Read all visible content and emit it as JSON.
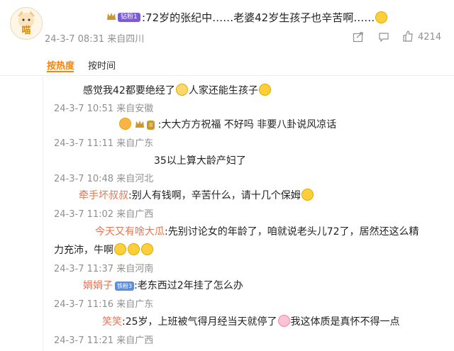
{
  "post": {
    "avatar_text": "喵",
    "badge_label": "钻粉1",
    "text": ":72岁的张纪中……老婆42岁生孩子也辛苦啊……",
    "timestamp": "24-3-7 08:31 来自四川",
    "like_count": "4214"
  },
  "tabs": {
    "hot": "按热度",
    "time": "按时间"
  },
  "comments": [
    {
      "text": "感觉我42都要绝经了",
      "text2": "人家还能生孩子",
      "meta": "24-3-7 10:51 来自安徽"
    },
    {
      "text": ":大大方方祝福 不好吗 非要八卦说风凉话",
      "meta": "24-3-7 11:11 来自广东"
    },
    {
      "text": "35以上算大龄产妇了",
      "meta": "24-3-7 10:48 来自河北"
    },
    {
      "user": "牵手坏叔叔",
      "text": ":别人有钱啊，辛苦什么，请十几个保姆",
      "meta": "24-3-7 11:02 来自广西"
    },
    {
      "user": "今天又有啥大瓜",
      "text": ":先别讨论女的年龄了，咱就说老头儿72了，居然还这么精",
      "text2": "力充沛，牛啊",
      "meta": "24-3-7 11:37 来自河南"
    },
    {
      "user": "娟娟子",
      "vip": "铁粉3",
      "text": ":老东西过2年挂了怎么办",
      "meta": "24-3-7 11:16 来自广东"
    },
    {
      "user": "笑笑",
      "text": ":25岁，上班被气得月经当天就停了",
      "text2": "我这体质是真怀不得一点",
      "meta": "24-3-7 11:21 来自广西"
    }
  ],
  "colors": {
    "accent": "#ff8200",
    "username": "#eb7350",
    "meta": "#8f8f8f"
  }
}
